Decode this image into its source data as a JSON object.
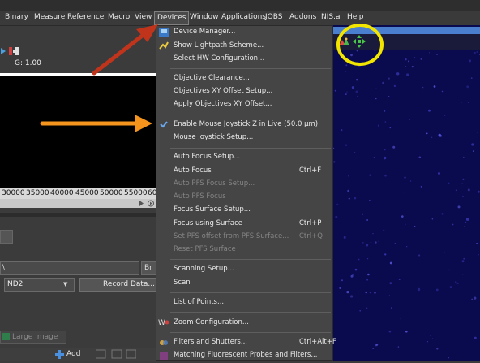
{
  "menubar": {
    "items": [
      "Binary",
      "Measure",
      "Reference",
      "Macro",
      "View",
      "Devices",
      "Window",
      "Applications",
      "JOBS",
      "Addons",
      "NIS.a",
      "Help"
    ]
  },
  "left_panel": {
    "gain_label": "G: 1.00",
    "axis_ticks": [
      "30000",
      "35000",
      "40000",
      "45000",
      "50000",
      "55000",
      "60"
    ],
    "path_value": "\\",
    "browse_label": "Br",
    "format_value": "ND2",
    "record_button": "Record Data...",
    "large_image_tab": "Large Image",
    "add_button": "Add"
  },
  "devices_menu": {
    "items": [
      {
        "label": "Device Manager...",
        "shortcut": "",
        "enabled": true
      },
      {
        "label": "Show Lightpath Scheme...",
        "shortcut": "",
        "enabled": true
      },
      {
        "label": "Select HW Configuration...",
        "shortcut": "",
        "enabled": true
      },
      {
        "label": "Objective Clearance...",
        "shortcut": "",
        "enabled": true
      },
      {
        "label": "Objectives XY Offset Setup...",
        "shortcut": "",
        "enabled": true
      },
      {
        "label": "Apply Objectives XY Offset...",
        "shortcut": "",
        "enabled": true
      },
      {
        "label": "Enable Mouse Joystick Z in Live (50.0 µm)",
        "shortcut": "",
        "enabled": true,
        "checked": true
      },
      {
        "label": "Mouse Joystick Setup...",
        "shortcut": "",
        "enabled": true
      },
      {
        "label": "Auto Focus Setup...",
        "shortcut": "",
        "enabled": true
      },
      {
        "label": "Auto Focus",
        "shortcut": "Ctrl+F",
        "enabled": true
      },
      {
        "label": "Auto PFS Focus Setup...",
        "shortcut": "",
        "enabled": false
      },
      {
        "label": "Auto PFS Focus",
        "shortcut": "",
        "enabled": false
      },
      {
        "label": "Focus Surface Setup...",
        "shortcut": "",
        "enabled": true
      },
      {
        "label": "Focus using Surface",
        "shortcut": "Ctrl+P",
        "enabled": true
      },
      {
        "label": "Set PFS offset from PFS Surface...",
        "shortcut": "Ctrl+Q",
        "enabled": false
      },
      {
        "label": "Reset PFS Surface",
        "shortcut": "",
        "enabled": false
      },
      {
        "label": "Scanning Setup...",
        "shortcut": "",
        "enabled": true
      },
      {
        "label": "Scan",
        "shortcut": "",
        "enabled": true
      },
      {
        "label": "List of Points...",
        "shortcut": "",
        "enabled": true
      },
      {
        "label": "Zoom Configuration...",
        "shortcut": "",
        "enabled": true
      },
      {
        "label": "Filters and Shutters...",
        "shortcut": "Ctrl+Alt+F",
        "enabled": true
      },
      {
        "label": "Matching Fluorescent Probes and Filters...",
        "shortcut": "",
        "enabled": true
      }
    ]
  },
  "colors": {
    "annotation_circle": "#f2e600",
    "arrow_red": "#c0341c",
    "arrow_orange": "#f5951e",
    "image_background": "#0a0a4e"
  }
}
